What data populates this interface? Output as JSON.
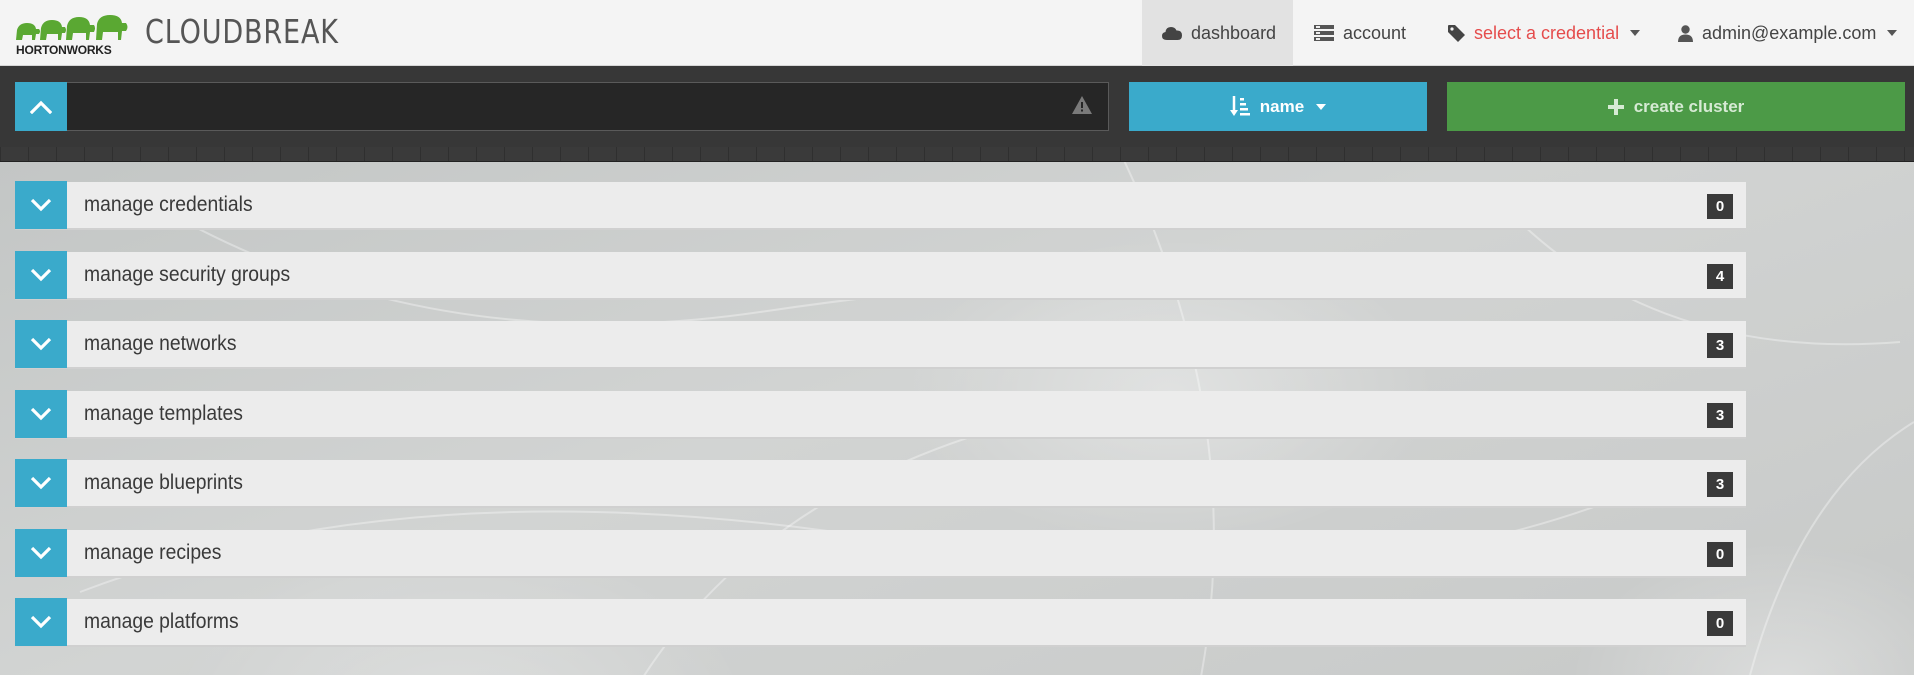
{
  "brand": {
    "logo_text": "HORTONWORKS",
    "app_title": "CLOUDBREAK"
  },
  "nav": {
    "dashboard": "dashboard",
    "account": "account",
    "credential": "select a credential",
    "user": "admin@example.com"
  },
  "toolbar": {
    "search_value": "",
    "sort_label": "name",
    "create_label": "create cluster"
  },
  "panels": [
    {
      "label": "manage credentials",
      "count": "0"
    },
    {
      "label": "manage security groups",
      "count": "4"
    },
    {
      "label": "manage networks",
      "count": "3"
    },
    {
      "label": "manage templates",
      "count": "3"
    },
    {
      "label": "manage blueprints",
      "count": "3"
    },
    {
      "label": "manage recipes",
      "count": "0"
    },
    {
      "label": "manage platforms",
      "count": "0"
    }
  ],
  "colors": {
    "accent": "#3aaacb",
    "create": "#4c9a47",
    "credential": "#e54c4c",
    "logo_green": "#5aa832"
  }
}
